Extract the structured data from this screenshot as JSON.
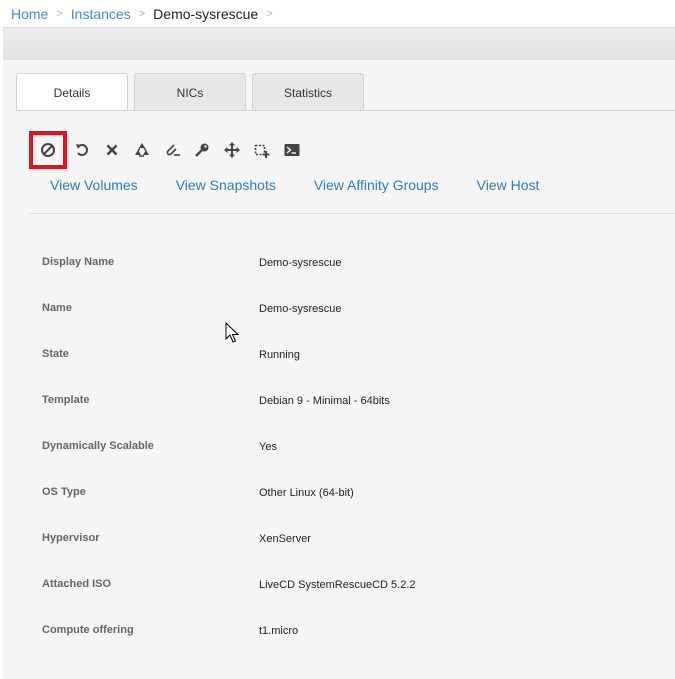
{
  "breadcrumb": {
    "home": "Home",
    "instances": "Instances",
    "current": "Demo-sysrescue",
    "separator": ">"
  },
  "tabs": [
    {
      "label": "Details",
      "active": true
    },
    {
      "label": "NICs",
      "active": false
    },
    {
      "label": "Statistics",
      "active": false
    }
  ],
  "toolbar": {
    "actions": [
      {
        "name": "stop-icon",
        "highlighted": true
      },
      {
        "name": "reboot-icon"
      },
      {
        "name": "destroy-icon"
      },
      {
        "name": "reinstall-icon"
      },
      {
        "name": "detach-iso-icon"
      },
      {
        "name": "reset-password-icon"
      },
      {
        "name": "migrate-icon"
      },
      {
        "name": "scale-up-icon"
      },
      {
        "name": "console-icon"
      }
    ],
    "highlight_color": "#e0141e"
  },
  "view_links": [
    "View Volumes",
    "View Snapshots",
    "View Affinity Groups",
    "View Host"
  ],
  "details": [
    {
      "label": "Display Name",
      "value": "Demo-sysrescue"
    },
    {
      "label": "Name",
      "value": "Demo-sysrescue"
    },
    {
      "label": "State",
      "value": "Running"
    },
    {
      "label": "Template",
      "value": "Debian 9 - Minimal - 64bits"
    },
    {
      "label": "Dynamically Scalable",
      "value": "Yes"
    },
    {
      "label": "OS Type",
      "value": "Other Linux (64-bit)"
    },
    {
      "label": "Hypervisor",
      "value": "XenServer"
    },
    {
      "label": "Attached ISO",
      "value": "LiveCD SystemRescueCD 5.2.2"
    },
    {
      "label": "Compute offering",
      "value": "t1.micro"
    }
  ],
  "colors": {
    "link": "#2f7db6",
    "breadcrumb_link": "#3e90c4",
    "label": "#666666"
  }
}
